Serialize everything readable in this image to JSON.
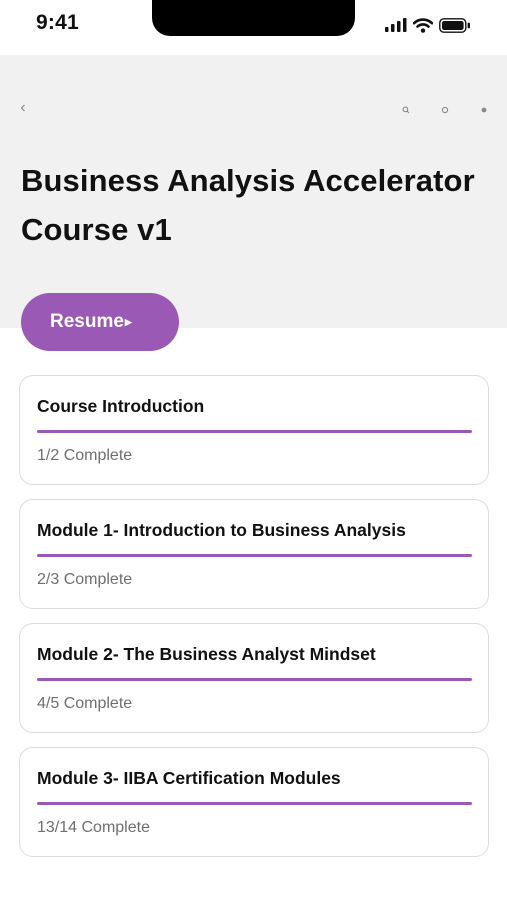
{
  "status_bar": {
    "time": "9:41"
  },
  "course": {
    "title": "Business Analysis Accelerator Course v1",
    "resume_label": "Resume",
    "accent_color": "#9b59b6"
  },
  "modules": [
    {
      "title": "Course Introduction",
      "status": "1/2 Complete",
      "progress": 1.0
    },
    {
      "title": "Module 1- Introduction to Business Analysis",
      "status": "2/3 Complete",
      "progress": 1.0
    },
    {
      "title": "Module 2- The Business Analyst Mindset",
      "status": "4/5 Complete",
      "progress": 1.0
    },
    {
      "title": "Module 3- IIBA Certification Modules",
      "status": "13/14 Complete",
      "progress": 1.0
    }
  ],
  "icons": {
    "signal": "cellular-signal-icon",
    "wifi": "wifi-icon",
    "battery": "battery-icon",
    "back": "chevron-left-icon",
    "search": "search-icon",
    "bookmark": "circle-icon",
    "more": "dot-icon"
  }
}
